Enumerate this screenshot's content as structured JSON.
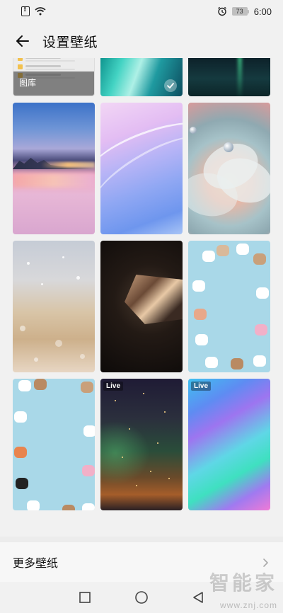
{
  "status_bar": {
    "battery_level": "73",
    "time": "6:00",
    "icons": [
      "sim-alert-icon",
      "wifi-icon",
      "alarm-icon",
      "battery-icon"
    ]
  },
  "header": {
    "title": "设置壁纸",
    "back_icon": "arrow-left-icon"
  },
  "gallery": {
    "label": "图库"
  },
  "wallpapers": [
    {
      "name": "gallery",
      "selected": false,
      "live": false
    },
    {
      "name": "aurora-teal",
      "selected": true,
      "live": false
    },
    {
      "name": "night-aurora",
      "selected": false,
      "live": false
    },
    {
      "name": "sunset-city",
      "selected": false,
      "live": false
    },
    {
      "name": "violet-ribbon",
      "selected": false,
      "live": false
    },
    {
      "name": "water-drop-flower",
      "selected": false,
      "live": false
    },
    {
      "name": "gold-glitter",
      "selected": false,
      "live": false
    },
    {
      "name": "dark-diamond",
      "selected": false,
      "live": false
    },
    {
      "name": "cute-animals-1",
      "selected": false,
      "live": false
    },
    {
      "name": "cute-animals-2",
      "selected": false,
      "live": false
    },
    {
      "name": "starry-aurora",
      "selected": false,
      "live": true
    },
    {
      "name": "holographic-gradient",
      "selected": false,
      "live": true
    }
  ],
  "live_label": "Live",
  "more": {
    "label": "更多壁纸",
    "chevron_icon": "chevron-right-icon"
  },
  "nav_bar": {
    "icons": [
      "square-recents-icon",
      "circle-home-icon",
      "triangle-back-icon"
    ]
  },
  "watermark": {
    "text": "智能家",
    "url": "www.znj.com"
  },
  "colors": {
    "background": "#f1f1f1",
    "text_primary": "#111111",
    "accent_check": "#ffffff"
  }
}
